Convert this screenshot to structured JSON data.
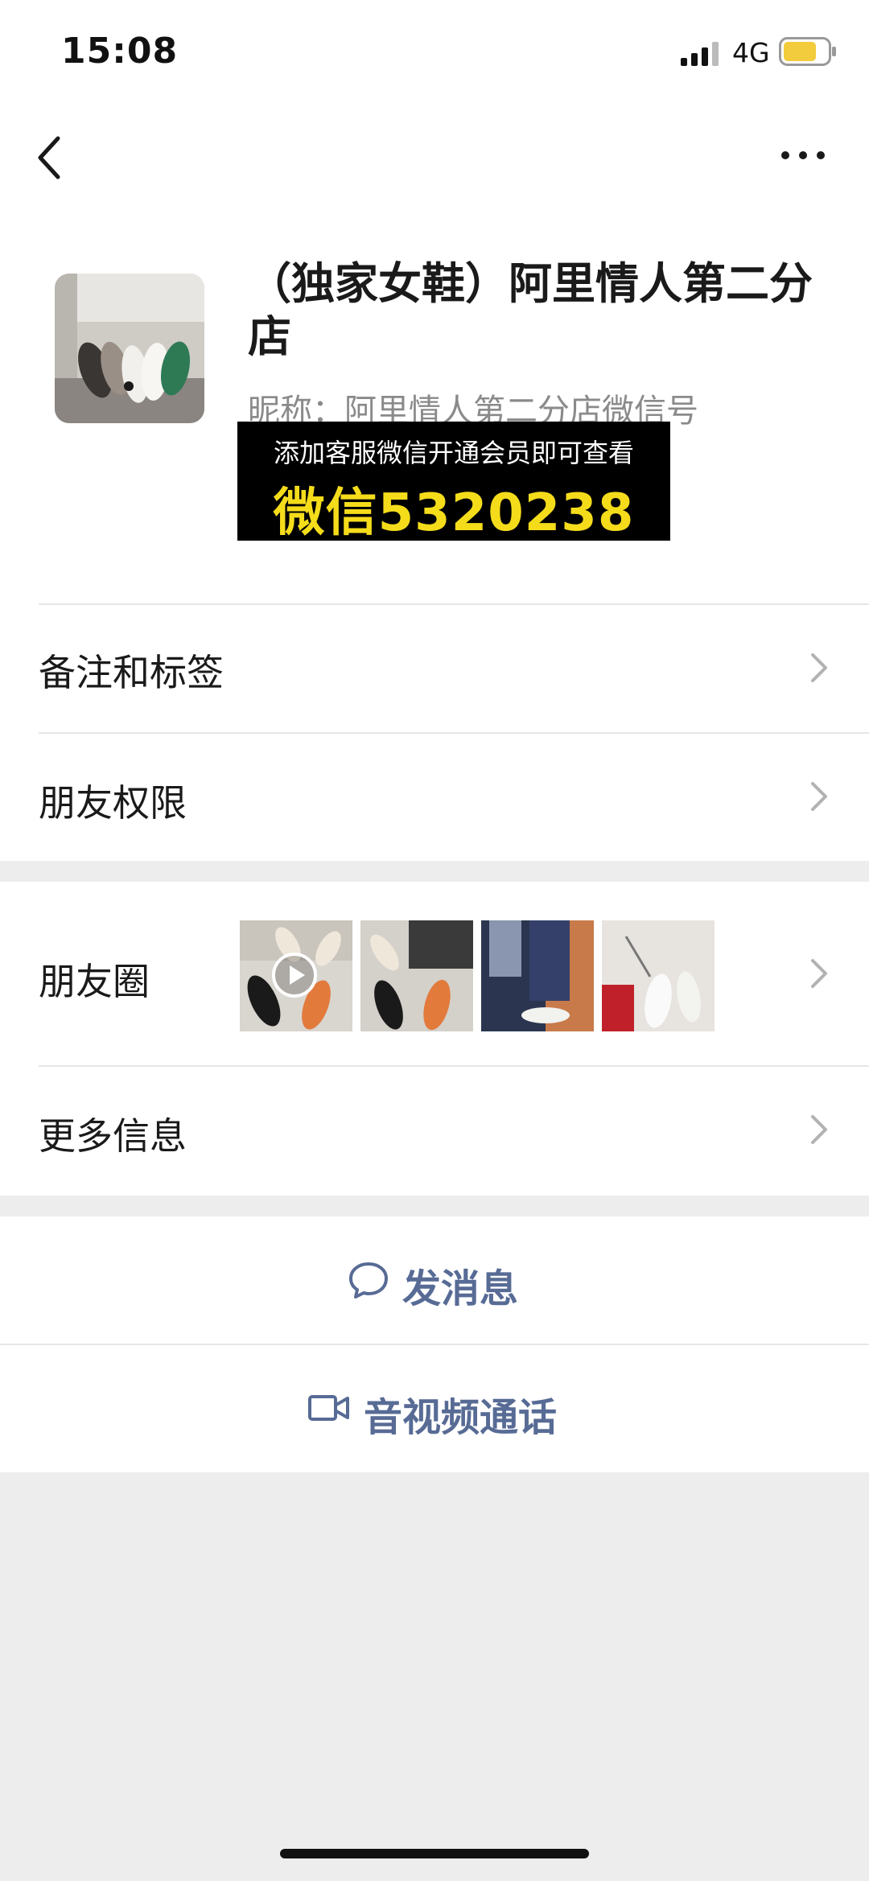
{
  "status_bar": {
    "time": "15:08",
    "network": "4G",
    "signal_icon": "signal-bars-icon",
    "battery_icon": "battery-icon",
    "battery_color": "#f2cc3d"
  },
  "nav": {
    "back_icon": "chevron-left-icon",
    "more_icon": "more-dots-icon"
  },
  "profile": {
    "name": "（独家女鞋）阿里情人第二分店",
    "nickname": "昵称：阿里情人第二分店微信号",
    "avatar_icon": "shoes-photo-avatar"
  },
  "overlay": {
    "line1": "添加客服微信开通会员即可查看",
    "line2": "微信5320238",
    "line2_color": "#f5dc1b"
  },
  "rows": {
    "remarks_tags": "备注和标签",
    "friend_permissions": "朋友权限",
    "moments": "朋友圈",
    "more_info": "更多信息"
  },
  "actions": {
    "send_message": "发消息",
    "video_call": "音视频通话",
    "accent_color": "#576b95"
  }
}
